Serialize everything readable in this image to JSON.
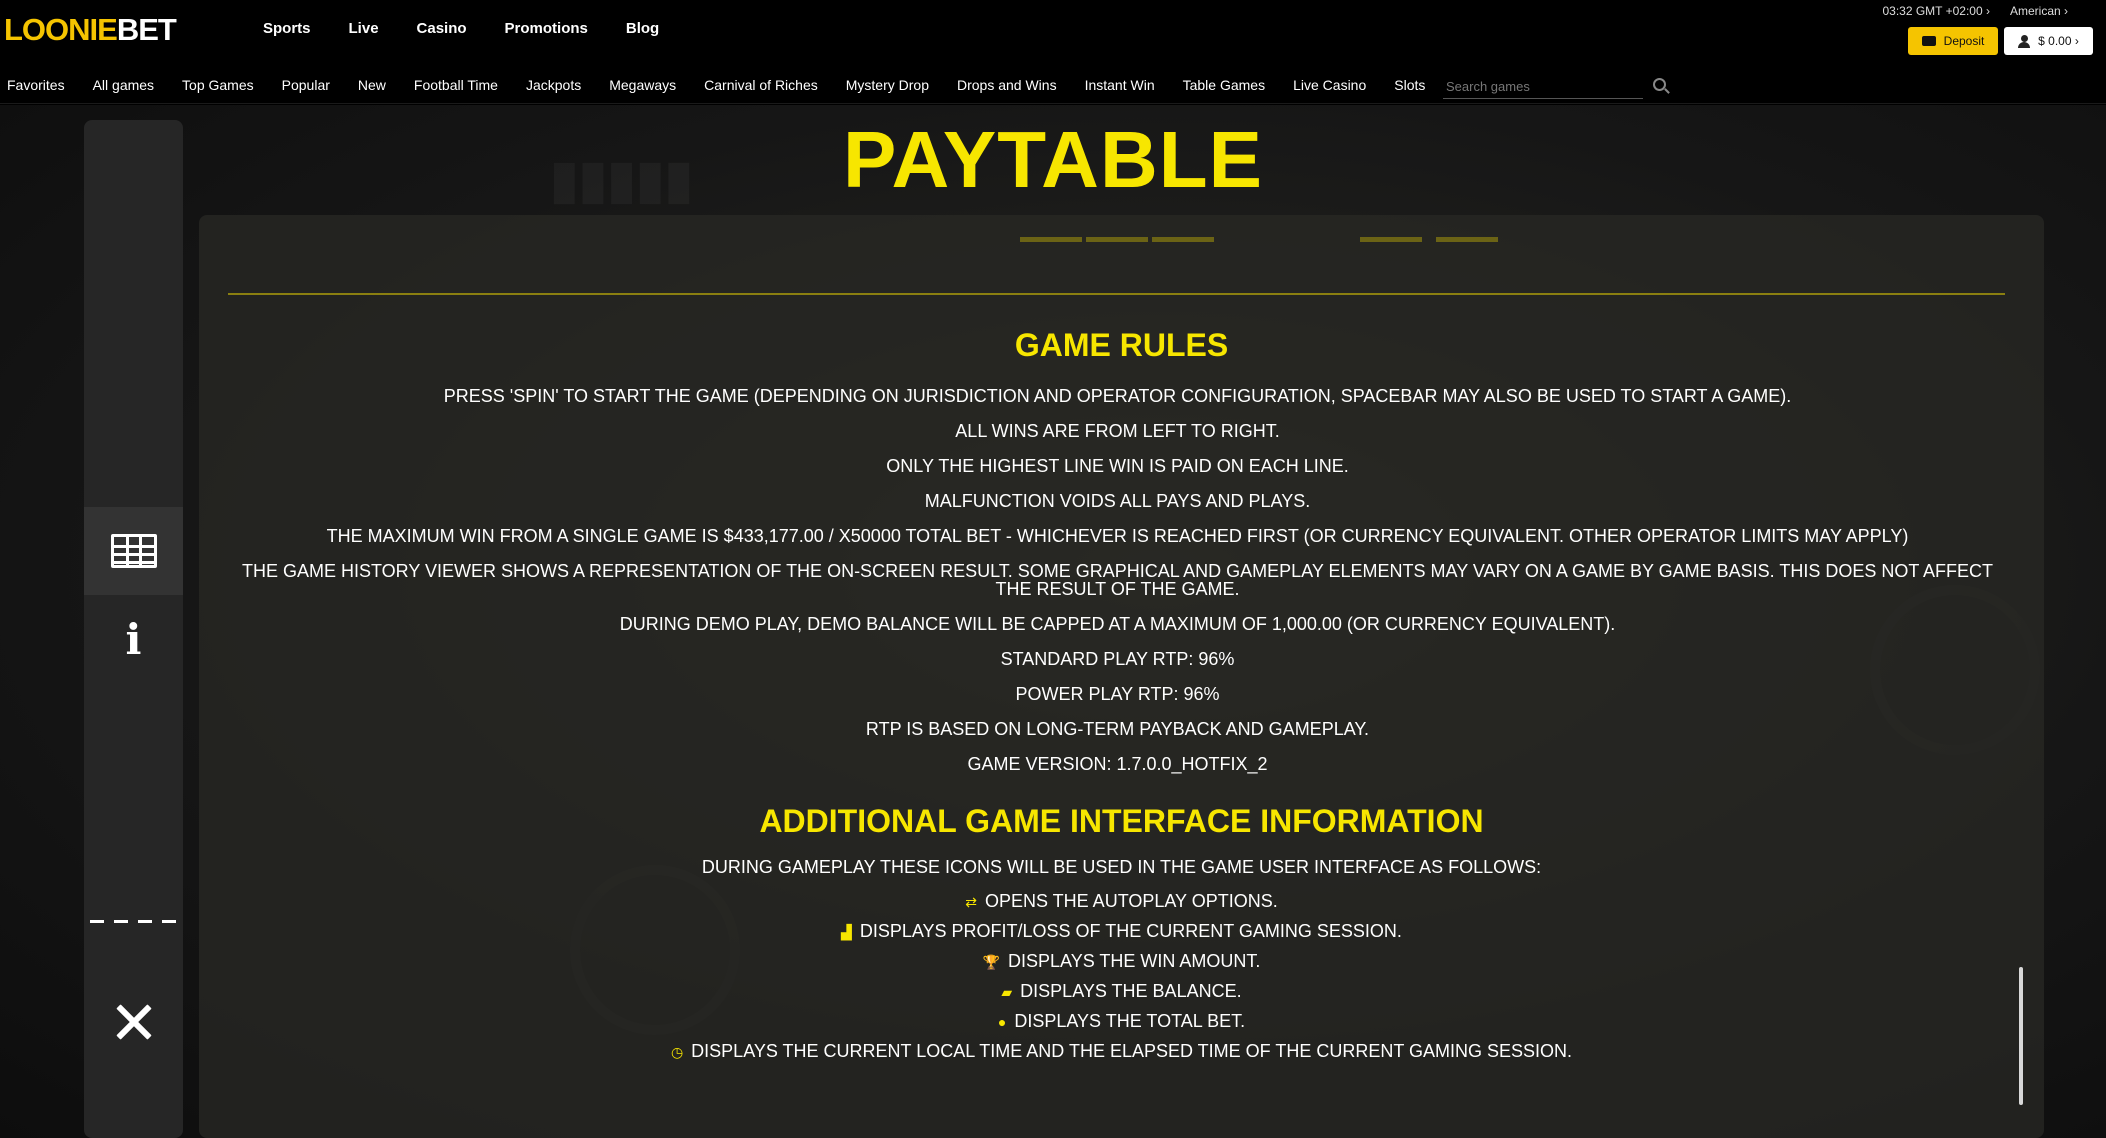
{
  "header": {
    "logo_looni": "LOONIE",
    "logo_bet": "BET",
    "nav": [
      "Sports",
      "Live",
      "Casino",
      "Promotions",
      "Blog"
    ],
    "time": "03:32  GMT +02:00 ›",
    "odds_format": "American ›",
    "deposit_label": "Deposit",
    "balance_label": "$ 0.00 ›"
  },
  "subnav": {
    "items": [
      "Favorites",
      "All games",
      "Top Games",
      "Popular",
      "New",
      "Football Time",
      "Jackpots",
      "Megaways",
      "Carnival of Riches",
      "Mystery Drop",
      "Drops and Wins",
      "Instant Win",
      "Table Games",
      "Live Casino",
      "Slots"
    ],
    "search_placeholder": "Search games"
  },
  "paytable": {
    "title": "PAYTABLE",
    "game_rules_title": "GAME RULES",
    "rules": [
      "PRESS 'SPIN' TO START THE GAME (DEPENDING ON JURISDICTION AND OPERATOR CONFIGURATION, SPACEBAR MAY ALSO BE USED TO START A GAME).",
      "ALL WINS ARE FROM LEFT TO RIGHT.",
      "ONLY THE HIGHEST LINE WIN IS PAID ON EACH LINE.",
      "MALFUNCTION VOIDS ALL PAYS AND PLAYS.",
      "THE MAXIMUM WIN FROM A SINGLE GAME IS $433,177.00 / X50000 TOTAL BET - WHICHEVER IS REACHED FIRST (OR CURRENCY EQUIVALENT. OTHER OPERATOR LIMITS MAY APPLY)",
      "THE GAME HISTORY VIEWER SHOWS A REPRESENTATION OF THE ON-SCREEN RESULT. SOME GRAPHICAL AND GAMEPLAY ELEMENTS MAY VARY ON A GAME BY GAME BASIS. THIS DOES NOT AFFECT THE RESULT OF THE GAME.",
      "DURING DEMO PLAY, DEMO BALANCE WILL BE CAPPED AT A MAXIMUM OF 1,000.00 (OR CURRENCY EQUIVALENT).",
      "STANDARD PLAY RTP: 96%",
      "POWER PLAY RTP: 96%",
      "RTP IS BASED ON LONG-TERM PAYBACK AND GAMEPLAY.",
      "GAME VERSION: 1.7.0.0_HOTFIX_2"
    ],
    "interface_title": "ADDITIONAL GAME INTERFACE INFORMATION",
    "interface_intro": "DURING GAMEPLAY THESE ICONS WILL BE USED IN THE GAME USER INTERFACE AS FOLLOWS:",
    "interface_items": [
      {
        "icon": "autoplay-icon",
        "glyph": "⇄",
        "text": "OPENS THE AUTOPLAY OPTIONS."
      },
      {
        "icon": "profit-chart-icon",
        "glyph": "▟",
        "text": "DISPLAYS PROFIT/LOSS OF THE CURRENT GAMING SESSION."
      },
      {
        "icon": "trophy-icon",
        "glyph": "🏆",
        "text": "DISPLAYS THE WIN AMOUNT."
      },
      {
        "icon": "wallet-icon",
        "glyph": "▰",
        "text": "DISPLAYS THE BALANCE."
      },
      {
        "icon": "coin-icon",
        "glyph": "●",
        "text": "DISPLAYS THE TOTAL BET."
      },
      {
        "icon": "clock-icon",
        "glyph": "◷",
        "text": "DISPLAYS THE CURRENT LOCAL TIME AND THE ELAPSED TIME OF THE CURRENT GAMING SESSION."
      }
    ]
  },
  "colors": {
    "accent": "#f7e600",
    "deposit": "#f5c400",
    "panel": "#28281f"
  }
}
